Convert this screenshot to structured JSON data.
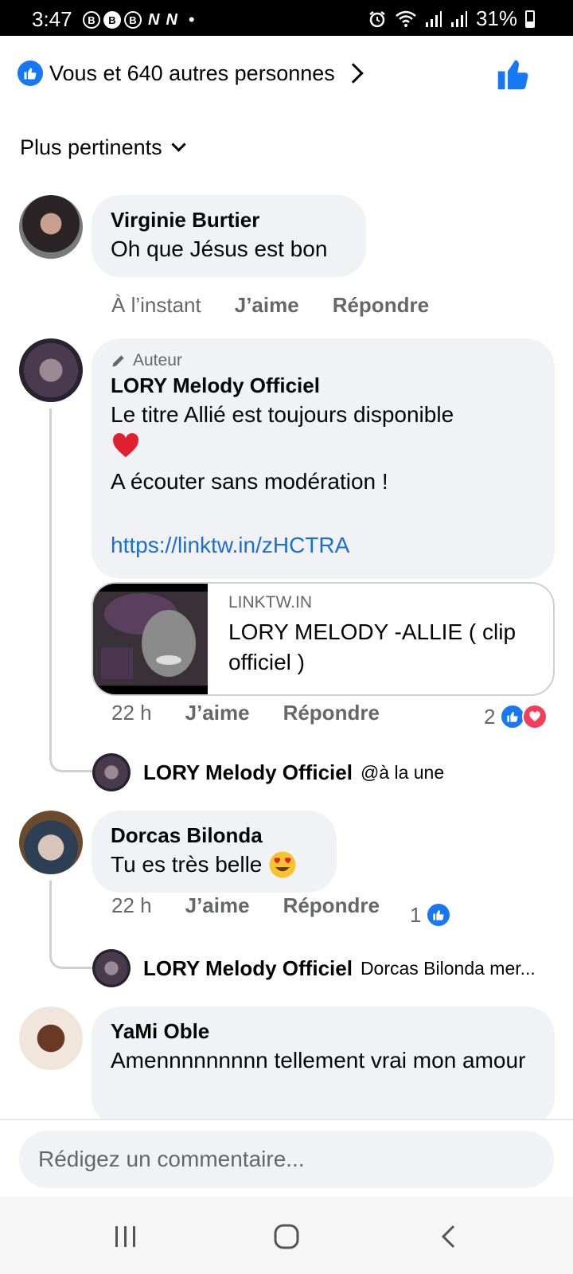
{
  "status_bar": {
    "time": "3:47",
    "notifications": [
      "B",
      "B",
      "B"
    ],
    "battery": "31%"
  },
  "header": {
    "likes_text": "Vous et 640 autres personnes",
    "sort_label": "Plus pertinents"
  },
  "comments": [
    {
      "name": "Virginie Burtier",
      "text": "Oh que Jésus est bon",
      "time": "À l’instant",
      "like": "J’aime",
      "reply": "Répondre"
    },
    {
      "badge": "Auteur",
      "name": "LORY Melody Officiel",
      "text_line1": "Le titre Allié est toujours disponible",
      "text_line3": "A écouter sans modération !",
      "link": "https://linktw.in/zHCTRA",
      "card_domain": "LINKTW.IN",
      "card_title": "LORY MELODY -ALLIE ( clip officiel )",
      "time": "22 h",
      "like": "J’aime",
      "reply": "Répondre",
      "reaction_count": "2",
      "reply_preview": {
        "name": "LORY Melody Officiel",
        "snippet": "@à la une"
      }
    },
    {
      "name": "Dorcas Bilonda",
      "text": "Tu es très belle",
      "time": "22 h",
      "like": "J’aime",
      "reply": "Répondre",
      "reaction_count": "1",
      "reply_preview": {
        "name": "LORY Melody Officiel",
        "snippet": "Dorcas Bilonda mer..."
      }
    },
    {
      "name": "YaMi Oble",
      "text": "Amennnnnnnnn tellement vrai mon amour"
    }
  ],
  "composer": {
    "placeholder": "Rédigez un commentaire..."
  },
  "colors": {
    "accent": "#1877f2",
    "bubble": "#f0f2f5",
    "secondary_text": "#65676b",
    "heart": "#f33e58"
  }
}
